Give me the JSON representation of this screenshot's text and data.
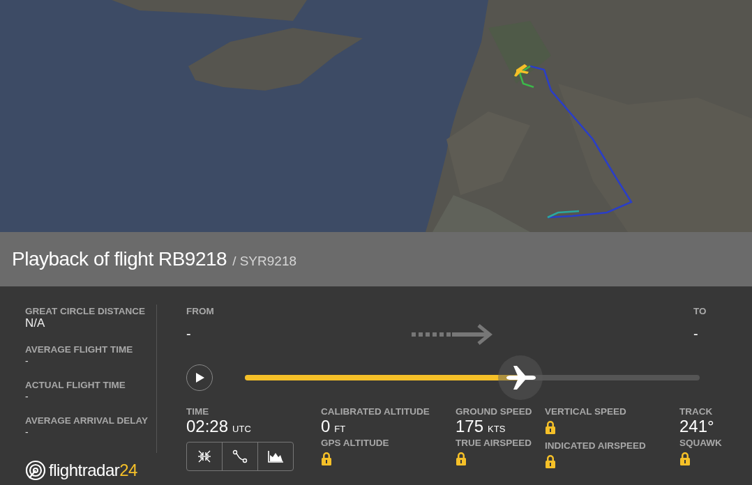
{
  "header": {
    "title": "Playback of flight RB9218",
    "subtitle": "/ SYR9218"
  },
  "summary": [
    {
      "label": "GREAT CIRCLE DISTANCE",
      "value": "N/A"
    },
    {
      "label": "AVERAGE FLIGHT TIME",
      "value": "-"
    },
    {
      "label": "ACTUAL FLIGHT TIME",
      "value": "-"
    },
    {
      "label": "AVERAGE ARRIVAL DELAY",
      "value": "-"
    }
  ],
  "logo": {
    "name": "flightradar",
    "suffix": "24"
  },
  "route": {
    "from_label": "FROM",
    "from_value": "-",
    "to_label": "TO",
    "to_value": "-"
  },
  "playback": {
    "playing": false,
    "level": 0.606
  },
  "stats": [
    {
      "items": [
        {
          "label": "TIME",
          "value": "02:28",
          "unit": "UTC",
          "locked": false
        }
      ],
      "tools": [
        {
          "kind": "collapse"
        },
        {
          "kind": "route"
        },
        {
          "kind": "chart"
        }
      ]
    },
    {
      "items": [
        {
          "label": "CALIBRATED ALTITUDE",
          "value": "0",
          "unit": "FT",
          "locked": false
        },
        {
          "label": "GPS ALTITUDE",
          "locked": true
        }
      ]
    },
    {
      "items": [
        {
          "label": "GROUND SPEED",
          "value": "175",
          "unit": "KTS",
          "locked": false
        },
        {
          "label": "TRUE AIRSPEED",
          "locked": true
        }
      ]
    },
    {
      "items": [
        {
          "label": "VERTICAL SPEED",
          "locked": true
        },
        {
          "label": "INDICATED AIRSPEED",
          "locked": true
        }
      ]
    },
    {
      "items": [
        {
          "label": "TRACK",
          "value": "241°",
          "locked": false
        },
        {
          "label": "SQUAWK",
          "locked": true
        }
      ]
    }
  ]
}
